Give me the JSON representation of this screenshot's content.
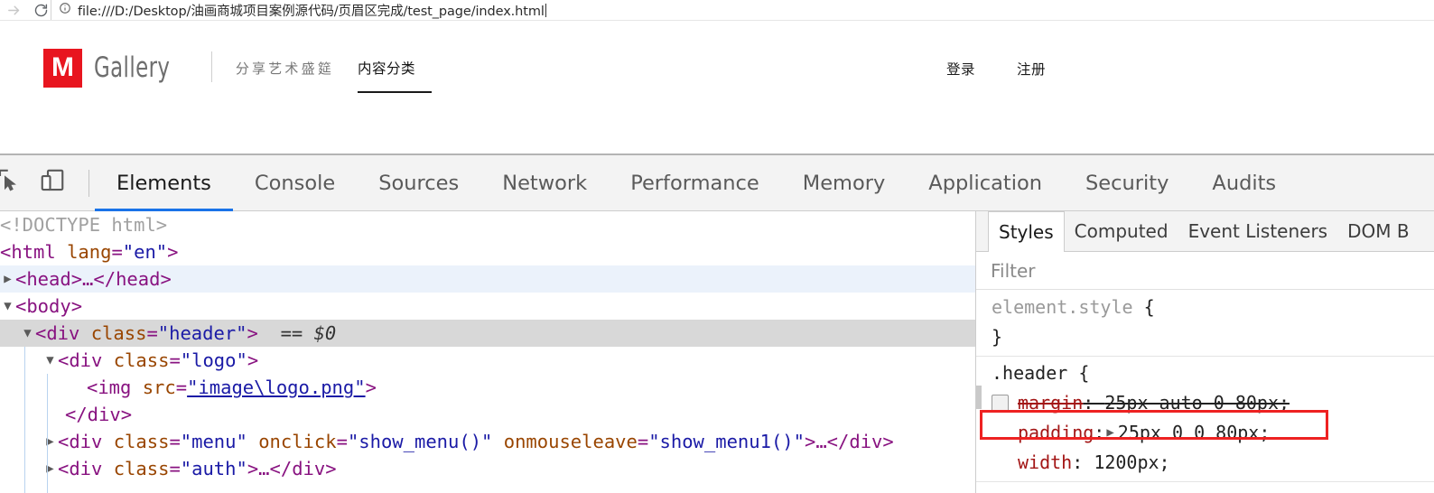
{
  "browser": {
    "forward_icon": "forward-arrow-icon",
    "reload_icon": "reload-icon",
    "info_icon": "page-info-icon",
    "url": "file:///D:/Desktop/油画商城项目案例源代码/页眉区完成/test_page/index.html"
  },
  "page": {
    "logo": {
      "mark": "M",
      "word": "Gallery"
    },
    "slogan": "分享艺术盛筵",
    "nav": {
      "label": "内容分类"
    },
    "auth": {
      "login": "登录",
      "register": "注册"
    }
  },
  "devtools": {
    "icons": {
      "inspect": "inspect-element-icon",
      "device": "device-toolbar-icon"
    },
    "tabs": [
      {
        "label": "Elements",
        "active": true
      },
      {
        "label": "Console",
        "active": false
      },
      {
        "label": "Sources",
        "active": false
      },
      {
        "label": "Network",
        "active": false
      },
      {
        "label": "Performance",
        "active": false
      },
      {
        "label": "Memory",
        "active": false
      },
      {
        "label": "Application",
        "active": false
      },
      {
        "label": "Security",
        "active": false
      },
      {
        "label": "Audits",
        "active": false
      }
    ],
    "dom": {
      "row_doctype": "<!DOCTYPE html>",
      "row_html_open": "<html",
      "row_html_attr": "lang",
      "row_html_val": "\"en\"",
      "row_html_close": ">",
      "row_head": "<head>…</head>",
      "row_body": "<body>",
      "row_header_tag": "<div",
      "row_header_attr": "class",
      "row_header_val": "\"header\"",
      "row_header_end": ">",
      "row_header_selected": "== $0",
      "row_logo_tag": "<div",
      "row_logo_attr": "class",
      "row_logo_val": "\"logo\"",
      "row_logo_end": ">",
      "row_img_tag": "<img",
      "row_img_attr": "src",
      "row_img_val": "\"image\\logo.png\"",
      "row_img_end": ">",
      "row_div_close": "</div>",
      "row_menu_tag": "<div",
      "row_menu_attr1": "class",
      "row_menu_val1": "\"menu\"",
      "row_menu_attr2": "onclick",
      "row_menu_val2": "\"show_menu()\"",
      "row_menu_attr3": "onmouseleave",
      "row_menu_val3": "\"show_menu1()\"",
      "row_menu_end": ">…</div>",
      "row_auth_tag": "<div",
      "row_auth_attr": "class",
      "row_auth_val": "\"auth\"",
      "row_auth_end": ">…</div>",
      "ellipsis": "…"
    },
    "styles": {
      "tabs": [
        {
          "label": "Styles",
          "active": true
        },
        {
          "label": "Computed",
          "active": false
        },
        {
          "label": "Event Listeners",
          "active": false
        },
        {
          "label": "DOM B",
          "active": false
        }
      ],
      "filter_placeholder": "Filter",
      "rules": [
        {
          "selector": "element.style",
          "open_brace": "{",
          "close_brace": "}",
          "declarations": []
        },
        {
          "selector": ".header",
          "open_brace": "{",
          "close_brace": "}",
          "declarations": [
            {
              "name": "margin",
              "value": "25px auto 0 80px;",
              "disabled": true,
              "checkbox": true,
              "expandable": false
            },
            {
              "name": "padding",
              "value": "25px 0 0 80px;",
              "disabled": false,
              "checkbox": false,
              "expandable": true,
              "highlighted": true
            },
            {
              "name": "width",
              "value": "1200px;",
              "disabled": false,
              "checkbox": false,
              "expandable": false
            }
          ]
        }
      ]
    }
  },
  "colors": {
    "logo_red": "#e8151f",
    "tab_accent": "#1a73e8",
    "annotation_red": "#ee2222",
    "css_property": "#a31515",
    "dom_tag": "#881280",
    "dom_attr": "#994500",
    "dom_value": "#1a1aa6"
  }
}
